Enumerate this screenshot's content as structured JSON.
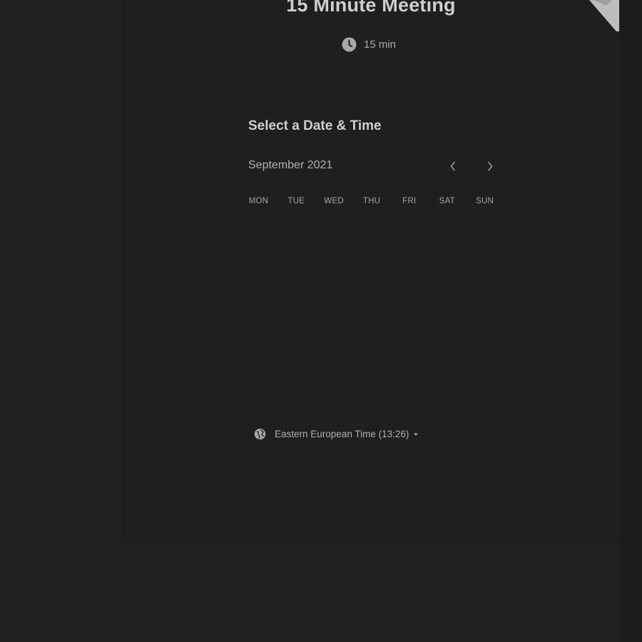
{
  "event": {
    "title": "15 Minute Meeting",
    "duration": "15 min"
  },
  "scheduler": {
    "section_title": "Select a Date & Time",
    "month": "September 2021",
    "weekdays": [
      "MON",
      "TUE",
      "WED",
      "THU",
      "FRI",
      "SAT",
      "SUN"
    ]
  },
  "timezone": {
    "label": "Eastern European Time (13:26)"
  },
  "icons": {
    "duration": "clock-icon",
    "prev": "chevron-left-icon",
    "next": "chevron-right-icon",
    "timezone": "globe-icon",
    "dropdown": "caret-down-icon"
  },
  "colors": {
    "background": "#202020",
    "text_primary": "#cfcfcf",
    "text_secondary": "#a9a9a9",
    "ribbon": "#bdbdbd"
  }
}
